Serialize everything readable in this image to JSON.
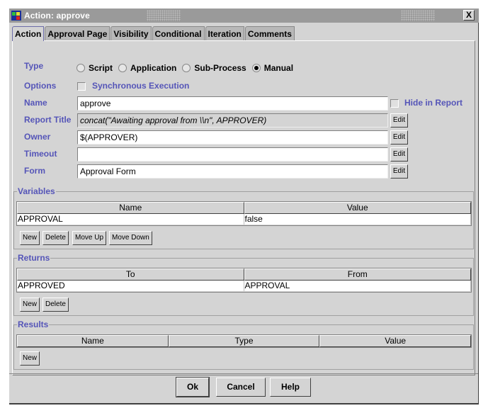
{
  "window": {
    "title": "Action: approve",
    "close_label": "X"
  },
  "tabs": [
    {
      "label": "Action",
      "active": true
    },
    {
      "label": "Approval Page",
      "active": false
    },
    {
      "label": "Visibility",
      "active": false
    },
    {
      "label": "Conditional",
      "active": false
    },
    {
      "label": "Iteration",
      "active": false
    },
    {
      "label": "Comments",
      "active": false
    }
  ],
  "form": {
    "type": {
      "label": "Type",
      "options": [
        "Script",
        "Application",
        "Sub-Process",
        "Manual"
      ],
      "selected": "Manual"
    },
    "options": {
      "label": "Options",
      "sync_label": "Synchronous Execution",
      "sync_checked": false
    },
    "name": {
      "label": "Name",
      "value": "approve",
      "hide_label": "Hide in Report",
      "hide_checked": false
    },
    "report_title": {
      "label": "Report Title",
      "value": "concat(\"Awaiting approval from \\\\n\", APPROVER)"
    },
    "owner": {
      "label": "Owner",
      "value": "$(APPROVER)"
    },
    "timeout": {
      "label": "Timeout",
      "value": ""
    },
    "form_field": {
      "label": "Form",
      "value": "Approval Form"
    },
    "edit_label": "Edit"
  },
  "variables": {
    "title": "Variables",
    "columns": [
      "Name",
      "Value"
    ],
    "rows": [
      [
        "APPROVAL",
        "false"
      ]
    ],
    "buttons": [
      "New",
      "Delete",
      "Move Up",
      "Move Down"
    ]
  },
  "returns": {
    "title": "Returns",
    "columns": [
      "To",
      "From"
    ],
    "rows": [
      [
        "APPROVED",
        "APPROVAL"
      ]
    ],
    "buttons": [
      "New",
      "Delete"
    ]
  },
  "results": {
    "title": "Results",
    "columns": [
      "Name",
      "Type",
      "Value"
    ],
    "rows": [],
    "buttons": [
      "New"
    ]
  },
  "dialog_buttons": {
    "ok": "Ok",
    "cancel": "Cancel",
    "help": "Help"
  }
}
